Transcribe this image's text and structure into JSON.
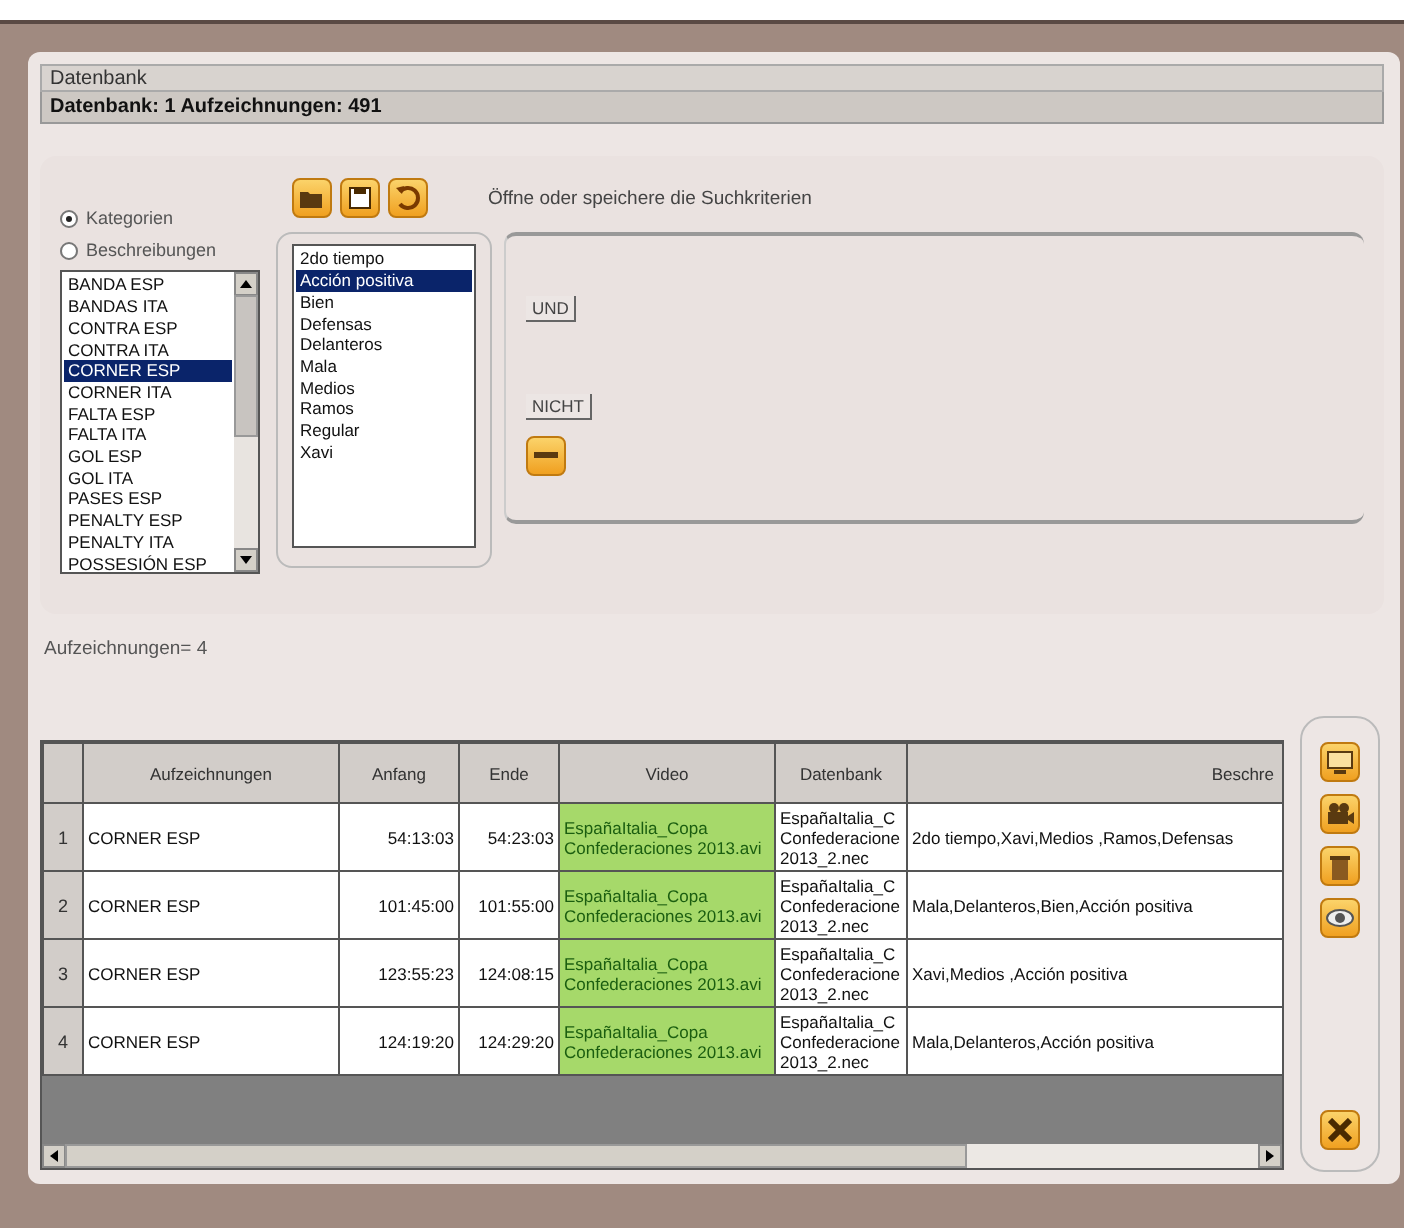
{
  "window": {
    "title": "Datenbank",
    "info": "Datenbank: 1 Aufzeichnungen: 491"
  },
  "search": {
    "modes": [
      {
        "label": "Kategorien",
        "selected": true
      },
      {
        "label": "Beschreibungen",
        "selected": false
      }
    ],
    "hint": "Öffne oder speichere die Suchkriterien",
    "categories": [
      {
        "label": "BANDA ESP",
        "selected": false
      },
      {
        "label": "BANDAS ITA",
        "selected": false
      },
      {
        "label": "CONTRA ESP",
        "selected": false
      },
      {
        "label": "CONTRA ITA",
        "selected": false
      },
      {
        "label": "CORNER ESP",
        "selected": true
      },
      {
        "label": "CORNER ITA",
        "selected": false
      },
      {
        "label": "FALTA ESP",
        "selected": false
      },
      {
        "label": "FALTA ITA",
        "selected": false
      },
      {
        "label": "GOL ESP",
        "selected": false
      },
      {
        "label": "GOL ITA",
        "selected": false
      },
      {
        "label": "PASES ESP",
        "selected": false
      },
      {
        "label": "PENALTY ESP",
        "selected": false
      },
      {
        "label": "PENALTY ITA",
        "selected": false
      },
      {
        "label": "POSSESIÓN ESP",
        "selected": false
      }
    ],
    "descriptions": [
      {
        "label": "2do tiempo",
        "selected": false
      },
      {
        "label": "Acción positiva",
        "selected": true
      },
      {
        "label": "Bien",
        "selected": false
      },
      {
        "label": "Defensas",
        "selected": false
      },
      {
        "label": "Delanteros",
        "selected": false
      },
      {
        "label": "Mala",
        "selected": false
      },
      {
        "label": "Medios",
        "selected": false
      },
      {
        "label": "Ramos",
        "selected": false
      },
      {
        "label": "Regular",
        "selected": false
      },
      {
        "label": "Xavi",
        "selected": false
      }
    ],
    "operators": [
      "UND",
      "NICHT"
    ]
  },
  "count": "Aufzeichnungen= 4",
  "table": {
    "columns": [
      "Aufzeichnungen",
      "Anfang",
      "Ende",
      "Video",
      "Datenbank",
      "Beschre"
    ],
    "rows": [
      {
        "number": "1",
        "recording": "CORNER ESP",
        "start": "54:13:03",
        "end": "54:23:03",
        "video": [
          "EspañaItalia_Copa",
          "Confederaciones 2013.avi"
        ],
        "database": [
          "EspañaItalia_C",
          "Confederacione",
          "2013_2.nec"
        ],
        "description": "2do tiempo,Xavi,Medios ,Ramos,Defensas"
      },
      {
        "number": "2",
        "recording": "CORNER ESP",
        "start": "101:45:00",
        "end": "101:55:00",
        "video": [
          "EspañaItalia_Copa",
          "Confederaciones 2013.avi"
        ],
        "database": [
          "EspañaItalia_C",
          "Confederacione",
          "2013_2.nec"
        ],
        "description": "Mala,Delanteros,Bien,Acción positiva"
      },
      {
        "number": "3",
        "recording": "CORNER ESP",
        "start": "123:55:23",
        "end": "124:08:15",
        "video": [
          "EspañaItalia_Copa",
          "Confederaciones 2013.avi"
        ],
        "database": [
          "EspañaItalia_C",
          "Confederacione",
          "2013_2.nec"
        ],
        "description": "Xavi,Medios ,Acción positiva"
      },
      {
        "number": "4",
        "recording": "CORNER ESP",
        "start": "124:19:20",
        "end": "124:29:20",
        "video": [
          "EspañaItalia_Copa",
          "Confederaciones 2013.avi"
        ],
        "database": [
          "EspañaItalia_C",
          "Confederacione",
          "2013_2.nec"
        ],
        "description": "Mala,Delanteros,Acción positiva"
      }
    ]
  }
}
